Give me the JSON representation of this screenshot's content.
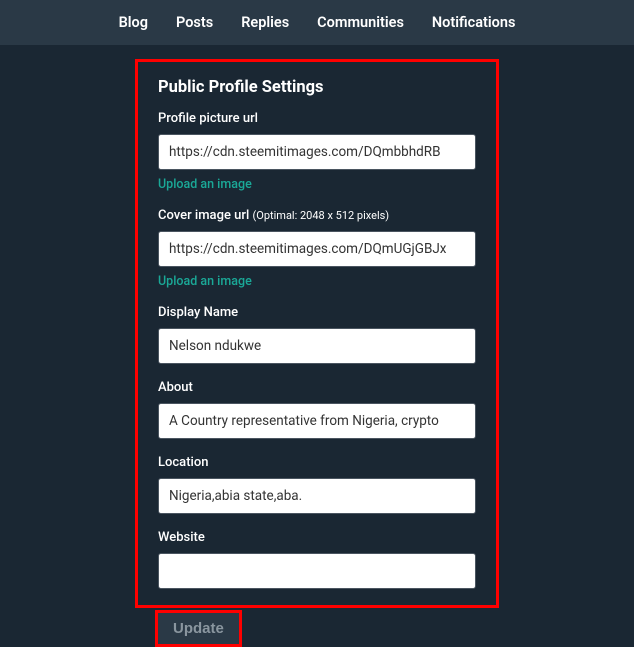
{
  "nav": {
    "items": [
      "Blog",
      "Posts",
      "Replies",
      "Communities",
      "Notifications"
    ]
  },
  "settings": {
    "title": "Public Profile Settings",
    "profile_picture": {
      "label": "Profile picture url",
      "value": "https://cdn.steemitimages.com/DQmbbhdRB",
      "upload_text": "Upload an image"
    },
    "cover_image": {
      "label": "Cover image url ",
      "hint": "(Optimal: 2048 x 512 pixels)",
      "value": "https://cdn.steemitimages.com/DQmUGjGBJx",
      "upload_text": "Upload an image"
    },
    "display_name": {
      "label": "Display Name",
      "value": "Nelson ndukwe"
    },
    "about": {
      "label": "About",
      "value": "A Country representative from Nigeria, crypto"
    },
    "location": {
      "label": "Location",
      "value": "Nigeria,abia state,aba."
    },
    "website": {
      "label": "Website",
      "value": ""
    },
    "update_button": "Update"
  }
}
